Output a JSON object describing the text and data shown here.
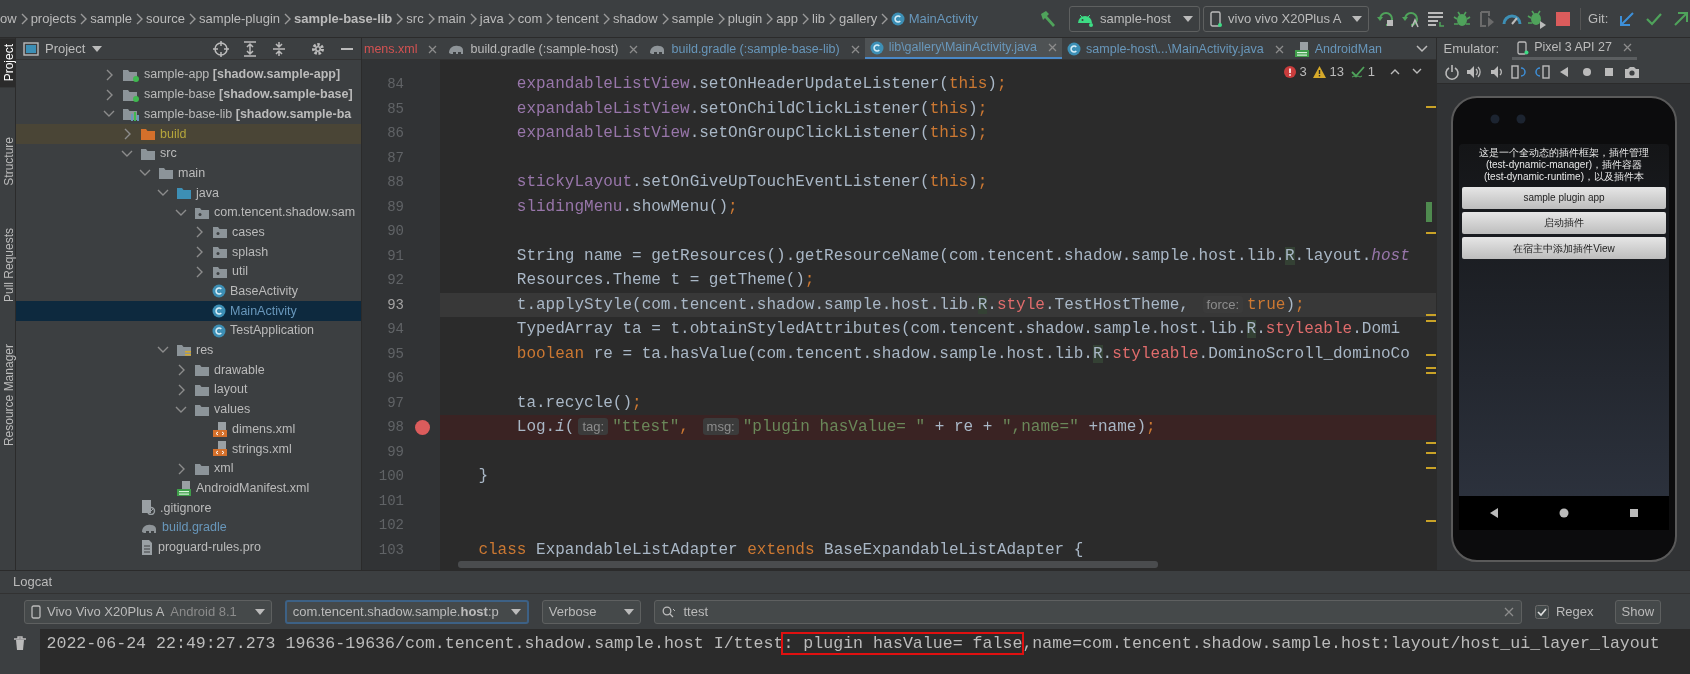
{
  "breadcrumbs": [
    {
      "label": "ow",
      "kind": "path",
      "bold": false
    },
    {
      "label": "projects",
      "kind": "path",
      "bold": false
    },
    {
      "label": "sample",
      "kind": "path",
      "bold": false
    },
    {
      "label": "source",
      "kind": "path",
      "bold": false
    },
    {
      "label": "sample-plugin",
      "kind": "path",
      "bold": false
    },
    {
      "label": "sample-base-lib",
      "kind": "path",
      "bold": true
    },
    {
      "label": "src",
      "kind": "path",
      "bold": false
    },
    {
      "label": "main",
      "kind": "path",
      "bold": false
    },
    {
      "label": "java",
      "kind": "path",
      "bold": false
    },
    {
      "label": "com",
      "kind": "path",
      "bold": false
    },
    {
      "label": "tencent",
      "kind": "path",
      "bold": false
    },
    {
      "label": "shadow",
      "kind": "path",
      "bold": false
    },
    {
      "label": "sample",
      "kind": "path",
      "bold": false
    },
    {
      "label": "plugin",
      "kind": "path",
      "bold": false
    },
    {
      "label": "app",
      "kind": "path",
      "bold": false
    },
    {
      "label": "lib",
      "kind": "path",
      "bold": false
    },
    {
      "label": "gallery",
      "kind": "path",
      "bold": false
    },
    {
      "label": "MainActivity",
      "kind": "class",
      "bold": false
    }
  ],
  "toolbar": {
    "run_config": "sample-host",
    "device": "vivo vivo X20Plus A",
    "git_label": "Git:"
  },
  "side_tabs": [
    {
      "label": "Project",
      "selected": true
    },
    {
      "label": "Structure",
      "selected": false
    },
    {
      "label": "Pull Requests",
      "selected": false
    },
    {
      "label": "Resource Manager",
      "selected": false
    }
  ],
  "project_panel": {
    "title": "Project",
    "tree": [
      {
        "label": "sample-app **[shadow.sample-app]**",
        "kind": "module",
        "expanded": false,
        "selected": false,
        "modified": false
      },
      {
        "label": "sample-base **[shadow.sample-base]**",
        "kind": "module",
        "expanded": false,
        "selected": false,
        "modified": false
      },
      {
        "label": "sample-base-lib **[shadow.sample-ba**",
        "kind": "library-module",
        "expanded": true,
        "selected": false,
        "modified": false,
        "children": [
          {
            "label": "build",
            "kind": "excluded-folder",
            "expanded": false,
            "selected": false,
            "modified": false
          },
          {
            "label": "src",
            "kind": "folder",
            "expanded": true,
            "selected": false,
            "modified": false,
            "children": [
              {
                "label": "main",
                "kind": "folder",
                "expanded": true,
                "selected": false,
                "modified": false,
                "children": [
                  {
                    "label": "java",
                    "kind": "source-folder",
                    "expanded": true,
                    "selected": false,
                    "modified": false,
                    "children": [
                      {
                        "label": "com.tencent.shadow.sam",
                        "kind": "package",
                        "expanded": true,
                        "selected": false,
                        "modified": false,
                        "children": [
                          {
                            "label": "cases",
                            "kind": "package",
                            "expanded": false,
                            "selected": false,
                            "modified": false
                          },
                          {
                            "label": "splash",
                            "kind": "package",
                            "expanded": false,
                            "selected": false,
                            "modified": false
                          },
                          {
                            "label": "util",
                            "kind": "package",
                            "expanded": false,
                            "selected": false,
                            "modified": false
                          },
                          {
                            "label": "BaseActivity",
                            "kind": "class",
                            "selected": false,
                            "modified": false
                          },
                          {
                            "label": "MainActivity",
                            "kind": "class",
                            "selected": true,
                            "modified": true
                          },
                          {
                            "label": "TestApplication",
                            "kind": "class",
                            "selected": false,
                            "modified": false
                          }
                        ]
                      }
                    ]
                  },
                  {
                    "label": "res",
                    "kind": "resource-folder",
                    "expanded": true,
                    "selected": false,
                    "modified": false,
                    "children": [
                      {
                        "label": "drawable",
                        "kind": "folder",
                        "expanded": false,
                        "selected": false,
                        "modified": false
                      },
                      {
                        "label": "layout",
                        "kind": "folder",
                        "expanded": false,
                        "selected": false,
                        "modified": false
                      },
                      {
                        "label": "values",
                        "kind": "folder",
                        "expanded": true,
                        "selected": false,
                        "modified": false,
                        "children": [
                          {
                            "label": "dimens.xml",
                            "kind": "xml",
                            "selected": false,
                            "modified": false
                          },
                          {
                            "label": "strings.xml",
                            "kind": "xml",
                            "selected": false,
                            "modified": false
                          }
                        ]
                      },
                      {
                        "label": "xml",
                        "kind": "folder",
                        "expanded": false,
                        "selected": false,
                        "modified": false
                      }
                    ]
                  },
                  {
                    "label": "AndroidManifest.xml",
                    "kind": "manifest",
                    "selected": false,
                    "modified": false
                  }
                ]
              }
            ]
          },
          {
            "label": ".gitignore",
            "kind": "ignore-file",
            "selected": false,
            "modified": false
          },
          {
            "label": "build.gradle",
            "kind": "gradle",
            "selected": false,
            "modified": true
          },
          {
            "label": "proguard-rules.pro",
            "kind": "text-file",
            "selected": false,
            "modified": false
          }
        ]
      }
    ]
  },
  "editor_tabs": [
    {
      "label": "mens.xml",
      "kind": "plain",
      "problem": true,
      "modified": false,
      "selected": false,
      "close_button": true
    },
    {
      "label": "build.gradle (:sample-host)",
      "kind": "gradle",
      "problem": false,
      "modified": false,
      "selected": false,
      "close_button": true
    },
    {
      "label": "build.gradle (:sample-base-lib)",
      "kind": "gradle",
      "problem": false,
      "modified": true,
      "selected": false,
      "close_button": true
    },
    {
      "label": "lib\\gallery\\MainActivity.java",
      "kind": "class",
      "problem": false,
      "modified": true,
      "selected": true,
      "close_button": true
    },
    {
      "label": "sample-host\\...\\MainActivity.java",
      "kind": "class",
      "problem": false,
      "modified": true,
      "selected": false,
      "close_button": true
    },
    {
      "label": "AndroidMan",
      "kind": "manifest",
      "problem": false,
      "modified": true,
      "selected": false,
      "close_button": false
    }
  ],
  "inspections": {
    "errors": "3",
    "warnings": "13",
    "typos": "1"
  },
  "code_lines": [
    {
      "number": "84",
      "breakpoint": false,
      "caret": false,
      "tokens": [
        {
          "kind": "field",
          "text": "        expandableListView"
        },
        {
          "kind": "plain",
          "text": ".setOnHeaderUpdateListener("
        },
        {
          "kind": "keyword",
          "text": "this"
        },
        {
          "kind": "plain",
          "text": ")"
        },
        {
          "kind": "keyword",
          "text": ";"
        }
      ]
    },
    {
      "number": "85",
      "breakpoint": false,
      "caret": false,
      "tokens": [
        {
          "kind": "field",
          "text": "        expandableListView"
        },
        {
          "kind": "plain",
          "text": ".setOnChildClickListener("
        },
        {
          "kind": "keyword",
          "text": "this"
        },
        {
          "kind": "plain",
          "text": ")"
        },
        {
          "kind": "keyword",
          "text": ";"
        }
      ]
    },
    {
      "number": "86",
      "breakpoint": false,
      "caret": false,
      "tokens": [
        {
          "kind": "field",
          "text": "        expandableListView"
        },
        {
          "kind": "plain",
          "text": ".setOnGroupClickListener("
        },
        {
          "kind": "keyword",
          "text": "this"
        },
        {
          "kind": "plain",
          "text": ")"
        },
        {
          "kind": "keyword",
          "text": ";"
        }
      ]
    },
    {
      "number": "87",
      "breakpoint": false,
      "caret": false
    },
    {
      "number": "88",
      "breakpoint": false,
      "caret": false,
      "tokens": [
        {
          "kind": "field",
          "text": "        stickyLayout"
        },
        {
          "kind": "plain",
          "text": ".setOnGiveUpTouchEventListener("
        },
        {
          "kind": "keyword",
          "text": "this"
        },
        {
          "kind": "plain",
          "text": ")"
        },
        {
          "kind": "keyword",
          "text": ";"
        }
      ]
    },
    {
      "number": "89",
      "breakpoint": false,
      "caret": false,
      "tokens": [
        {
          "kind": "field",
          "text": "        slidingMenu"
        },
        {
          "kind": "plain",
          "text": ".showMenu()"
        },
        {
          "kind": "keyword",
          "text": ";"
        }
      ]
    },
    {
      "number": "90",
      "breakpoint": false,
      "caret": false
    },
    {
      "number": "91",
      "breakpoint": false,
      "caret": false,
      "tokens": [
        {
          "kind": "plain",
          "text": "        String name = getResources().getResourceName(com.tencent.shadow.sample.host.lib."
        },
        {
          "kind": "marked",
          "text": "R"
        },
        {
          "kind": "plain",
          "text": ".layout."
        },
        {
          "kind": "italic-field",
          "text": "host"
        }
      ]
    },
    {
      "number": "92",
      "breakpoint": false,
      "caret": false,
      "tokens": [
        {
          "kind": "plain",
          "text": "        Resources.Theme t = getTheme()"
        },
        {
          "kind": "keyword",
          "text": ";"
        }
      ]
    },
    {
      "number": "93",
      "breakpoint": false,
      "caret": true,
      "tokens": [
        {
          "kind": "plain",
          "text": "        t.applyStyle(com.tencent.shadow.sample.host.lib."
        },
        {
          "kind": "marked",
          "text": "R"
        },
        {
          "kind": "plain",
          "text": "."
        },
        {
          "kind": "reference",
          "text": "style"
        },
        {
          "kind": "plain",
          "text": ".TestHostTheme, "
        },
        {
          "kind": "hint",
          "text": "force:"
        },
        {
          "kind": "keyword",
          "text": "true"
        },
        {
          "kind": "plain",
          "text": ")"
        },
        {
          "kind": "keyword",
          "text": ";"
        }
      ]
    },
    {
      "number": "94",
      "breakpoint": false,
      "caret": false,
      "tokens": [
        {
          "kind": "plain",
          "text": "        TypedArray ta = t.obtainStyledAttributes(com.tencent.shadow.sample.host.lib."
        },
        {
          "kind": "marked",
          "text": "R"
        },
        {
          "kind": "plain",
          "text": "."
        },
        {
          "kind": "reference",
          "text": "styleable"
        },
        {
          "kind": "plain",
          "text": ".Domi"
        }
      ]
    },
    {
      "number": "95",
      "breakpoint": false,
      "caret": false,
      "tokens": [
        {
          "kind": "keyword",
          "text": "        boolean"
        },
        {
          "kind": "plain",
          "text": " re = ta.hasValue(com.tencent.shadow.sample.host.lib."
        },
        {
          "kind": "marked",
          "text": "R"
        },
        {
          "kind": "plain",
          "text": "."
        },
        {
          "kind": "reference",
          "text": "styleable"
        },
        {
          "kind": "plain",
          "text": ".DominoScroll_dominoCo"
        }
      ]
    },
    {
      "number": "96",
      "breakpoint": false,
      "caret": false
    },
    {
      "number": "97",
      "breakpoint": false,
      "caret": false,
      "tokens": [
        {
          "kind": "plain",
          "text": "        ta.recycle()"
        },
        {
          "kind": "keyword",
          "text": ";"
        }
      ]
    },
    {
      "number": "98",
      "breakpoint": true,
      "caret": false,
      "tokens": [
        {
          "kind": "plain",
          "text": "        Log."
        },
        {
          "kind": "italic",
          "text": "i"
        },
        {
          "kind": "plain",
          "text": "("
        },
        {
          "kind": "hint",
          "text": "tag:"
        },
        {
          "kind": "string",
          "text": "\"ttest\""
        },
        {
          "kind": "keyword",
          "text": ", "
        },
        {
          "kind": "hint",
          "text": "msg:"
        },
        {
          "kind": "string",
          "text": "\"plugin hasValue= \""
        },
        {
          "kind": "plain",
          "text": " + re + "
        },
        {
          "kind": "string",
          "text": "\",name=\""
        },
        {
          "kind": "plain",
          "text": " +name)"
        },
        {
          "kind": "keyword",
          "text": ";"
        }
      ]
    },
    {
      "number": "99",
      "breakpoint": false,
      "caret": false
    },
    {
      "number": "100",
      "breakpoint": false,
      "caret": false,
      "tokens": [
        {
          "kind": "plain",
          "text": "    }"
        }
      ]
    },
    {
      "number": "101",
      "breakpoint": false,
      "caret": false
    },
    {
      "number": "102",
      "breakpoint": false,
      "caret": false
    },
    {
      "number": "103",
      "breakpoint": false,
      "caret": false,
      "tokens": [
        {
          "kind": "keyword",
          "text": "    class"
        },
        {
          "kind": "plain",
          "text": " ExpandableListAdapter "
        },
        {
          "kind": "keyword",
          "text": "extends"
        },
        {
          "kind": "plain",
          "text": " BaseExpandableListAdapter {"
        }
      ]
    }
  ],
  "emulator": {
    "label": "Emulator:",
    "tabs": [
      {
        "label": "Pixel 3 API 27",
        "selected": true
      }
    ],
    "phone": {
      "intro_lines": [
        "这是一个全动态的插件框架，插件管理",
        "(test-dynamic-manager)，插件容器",
        "(test-dynamic-runtime)，以及插件本"
      ],
      "buttons": [
        "sample plugin app",
        "启动插件",
        "在宿主中添加插件View"
      ]
    }
  },
  "logcat": {
    "title": "Logcat",
    "device": {
      "name": "Vivo Vivo X20Plus A",
      "api": "Android 8.1"
    },
    "process": "com.tencent.shadow.sample.**host**:p",
    "level": "Verbose",
    "search": "ttest",
    "regex": {
      "label": "Regex",
      "checked": true
    },
    "show_button": "Show",
    "lines": [
      {
        "before": "2022-06-24 22:49:27.273 19636-19636/com.tencent.shadow.sample.host I/ttest",
        "boxed": ": plugin hasValue= false",
        "after": ",name=com.tencent.shadow.sample.host:layout/host_ui_layer_layout"
      }
    ]
  }
}
